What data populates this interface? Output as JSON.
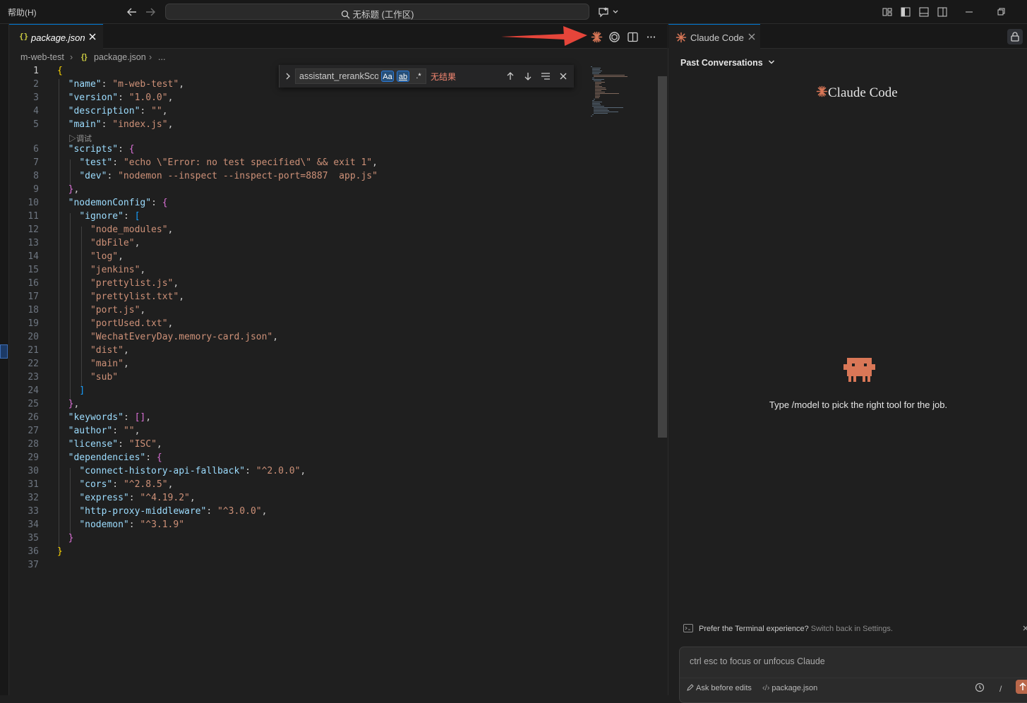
{
  "titlebar": {
    "menu_help": "帮助(H)",
    "command_center": "无标题 (工作区)"
  },
  "editor": {
    "tab_label": "package.json",
    "tab_glyph": "{}",
    "breadcrumb": {
      "folder": "m-web-test",
      "file_glyph": "{}",
      "file": "package.json",
      "ellipsis": "..."
    },
    "codelens": "▷调试",
    "lines": [
      {
        "n": "1",
        "t": [
          [
            "br1",
            "{"
          ]
        ]
      },
      {
        "n": "2",
        "t": [
          [
            "",
            "  "
          ],
          [
            "key",
            "\"name\""
          ],
          [
            "",
            ": "
          ],
          [
            "str",
            "\"m-web-test\""
          ],
          [
            "",
            ","
          ]
        ]
      },
      {
        "n": "3",
        "t": [
          [
            "",
            "  "
          ],
          [
            "key",
            "\"version\""
          ],
          [
            "",
            ": "
          ],
          [
            "str",
            "\"1.0.0\""
          ],
          [
            "",
            ","
          ]
        ]
      },
      {
        "n": "4",
        "t": [
          [
            "",
            "  "
          ],
          [
            "key",
            "\"description\""
          ],
          [
            "",
            ": "
          ],
          [
            "str",
            "\"\""
          ],
          [
            "",
            ","
          ]
        ]
      },
      {
        "n": "5",
        "t": [
          [
            "",
            "  "
          ],
          [
            "key",
            "\"main\""
          ],
          [
            "",
            ": "
          ],
          [
            "str",
            "\"index.js\""
          ],
          [
            "",
            ","
          ]
        ]
      },
      {
        "n": "6",
        "t": [
          [
            "",
            "  "
          ],
          [
            "key",
            "\"scripts\""
          ],
          [
            "",
            ": "
          ],
          [
            "br2",
            "{"
          ]
        ]
      },
      {
        "n": "7",
        "t": [
          [
            "",
            "    "
          ],
          [
            "key",
            "\"test\""
          ],
          [
            "",
            ": "
          ],
          [
            "str",
            "\"echo \\\"Error: no test specified\\\" && exit 1\""
          ],
          [
            "",
            ","
          ]
        ]
      },
      {
        "n": "8",
        "t": [
          [
            "",
            "    "
          ],
          [
            "key",
            "\"dev\""
          ],
          [
            "",
            ": "
          ],
          [
            "str",
            "\"nodemon --inspect --inspect-port=8887  app.js\""
          ]
        ]
      },
      {
        "n": "9",
        "t": [
          [
            "",
            "  "
          ],
          [
            "br2",
            "}"
          ],
          [
            "",
            ","
          ]
        ]
      },
      {
        "n": "10",
        "t": [
          [
            "",
            "  "
          ],
          [
            "key",
            "\"nodemonConfig\""
          ],
          [
            "",
            ": "
          ],
          [
            "br2",
            "{"
          ]
        ]
      },
      {
        "n": "11",
        "t": [
          [
            "",
            "    "
          ],
          [
            "key",
            "\"ignore\""
          ],
          [
            "",
            ": "
          ],
          [
            "br3",
            "["
          ]
        ]
      },
      {
        "n": "12",
        "t": [
          [
            "",
            "      "
          ],
          [
            "str",
            "\"node_modules\""
          ],
          [
            "",
            ","
          ]
        ]
      },
      {
        "n": "13",
        "t": [
          [
            "",
            "      "
          ],
          [
            "str",
            "\"dbFile\""
          ],
          [
            "",
            ","
          ]
        ]
      },
      {
        "n": "14",
        "t": [
          [
            "",
            "      "
          ],
          [
            "str",
            "\"log\""
          ],
          [
            "",
            ","
          ]
        ]
      },
      {
        "n": "15",
        "t": [
          [
            "",
            "      "
          ],
          [
            "str",
            "\"jenkins\""
          ],
          [
            "",
            ","
          ]
        ]
      },
      {
        "n": "16",
        "t": [
          [
            "",
            "      "
          ],
          [
            "str",
            "\"prettylist.js\""
          ],
          [
            "",
            ","
          ]
        ]
      },
      {
        "n": "17",
        "t": [
          [
            "",
            "      "
          ],
          [
            "str",
            "\"prettylist.txt\""
          ],
          [
            "",
            ","
          ]
        ]
      },
      {
        "n": "18",
        "t": [
          [
            "",
            "      "
          ],
          [
            "str",
            "\"port.js\""
          ],
          [
            "",
            ","
          ]
        ]
      },
      {
        "n": "19",
        "t": [
          [
            "",
            "      "
          ],
          [
            "str",
            "\"portUsed.txt\""
          ],
          [
            "",
            ","
          ]
        ]
      },
      {
        "n": "20",
        "t": [
          [
            "",
            "      "
          ],
          [
            "str",
            "\"WechatEveryDay.memory-card.json\""
          ],
          [
            "",
            ","
          ]
        ]
      },
      {
        "n": "21",
        "t": [
          [
            "",
            "      "
          ],
          [
            "str",
            "\"dist\""
          ],
          [
            "",
            ","
          ]
        ]
      },
      {
        "n": "22",
        "t": [
          [
            "",
            "      "
          ],
          [
            "str",
            "\"main\""
          ],
          [
            "",
            ","
          ]
        ]
      },
      {
        "n": "23",
        "t": [
          [
            "",
            "      "
          ],
          [
            "str",
            "\"sub\""
          ]
        ]
      },
      {
        "n": "24",
        "t": [
          [
            "",
            "    "
          ],
          [
            "br3",
            "]"
          ]
        ]
      },
      {
        "n": "25",
        "t": [
          [
            "",
            "  "
          ],
          [
            "br2",
            "}"
          ],
          [
            "",
            ","
          ]
        ]
      },
      {
        "n": "26",
        "t": [
          [
            "",
            "  "
          ],
          [
            "key",
            "\"keywords\""
          ],
          [
            "",
            ": "
          ],
          [
            "br2",
            "[]"
          ],
          [
            "",
            ","
          ]
        ]
      },
      {
        "n": "27",
        "t": [
          [
            "",
            "  "
          ],
          [
            "key",
            "\"author\""
          ],
          [
            "",
            ": "
          ],
          [
            "str",
            "\"\""
          ],
          [
            "",
            ","
          ]
        ]
      },
      {
        "n": "28",
        "t": [
          [
            "",
            "  "
          ],
          [
            "key",
            "\"license\""
          ],
          [
            "",
            ": "
          ],
          [
            "str",
            "\"ISC\""
          ],
          [
            "",
            ","
          ]
        ]
      },
      {
        "n": "29",
        "t": [
          [
            "",
            "  "
          ],
          [
            "key",
            "\"dependencies\""
          ],
          [
            "",
            ": "
          ],
          [
            "br2",
            "{"
          ]
        ]
      },
      {
        "n": "30",
        "t": [
          [
            "",
            "    "
          ],
          [
            "key",
            "\"connect-history-api-fallback\""
          ],
          [
            "",
            ": "
          ],
          [
            "str",
            "\"^2.0.0\""
          ],
          [
            "",
            ","
          ]
        ]
      },
      {
        "n": "31",
        "t": [
          [
            "",
            "    "
          ],
          [
            "key",
            "\"cors\""
          ],
          [
            "",
            ": "
          ],
          [
            "str",
            "\"^2.8.5\""
          ],
          [
            "",
            ","
          ]
        ]
      },
      {
        "n": "32",
        "t": [
          [
            "",
            "    "
          ],
          [
            "key",
            "\"express\""
          ],
          [
            "",
            ": "
          ],
          [
            "str",
            "\"^4.19.2\""
          ],
          [
            "",
            ","
          ]
        ]
      },
      {
        "n": "33",
        "t": [
          [
            "",
            "    "
          ],
          [
            "key",
            "\"http-proxy-middleware\""
          ],
          [
            "",
            ": "
          ],
          [
            "str",
            "\"^3.0.0\""
          ],
          [
            "",
            ","
          ]
        ]
      },
      {
        "n": "34",
        "t": [
          [
            "",
            "    "
          ],
          [
            "key",
            "\"nodemon\""
          ],
          [
            "",
            ": "
          ],
          [
            "str",
            "\"^3.1.9\""
          ]
        ]
      },
      {
        "n": "35",
        "t": [
          [
            "",
            "  "
          ],
          [
            "br2",
            "}"
          ]
        ]
      },
      {
        "n": "36",
        "t": [
          [
            "br1",
            "}"
          ]
        ]
      },
      {
        "n": "37",
        "t": []
      }
    ]
  },
  "find_widget": {
    "value": "assistant_rerankScore",
    "match_case": "Aa",
    "whole_word": "ab",
    "regex": ".*",
    "result": "无结果"
  },
  "claude_panel": {
    "tab_label": "Claude Code",
    "past_conversations": "Past Conversations",
    "logo_text": "Claude Code",
    "hint": "Type /model to pick the right tool for the job.",
    "terminal_note_main": "Prefer the Terminal experience?",
    "terminal_note_link": "Switch back in Settings.",
    "prompt_placeholder": "ctrl esc to focus or unfocus Claude",
    "mode_label": "Ask before edits",
    "context_file": "package.json",
    "slash": "/"
  },
  "colors": {
    "accent": "#0078d4",
    "claude_orange": "#d97757",
    "annotation_red": "#e5453a"
  }
}
